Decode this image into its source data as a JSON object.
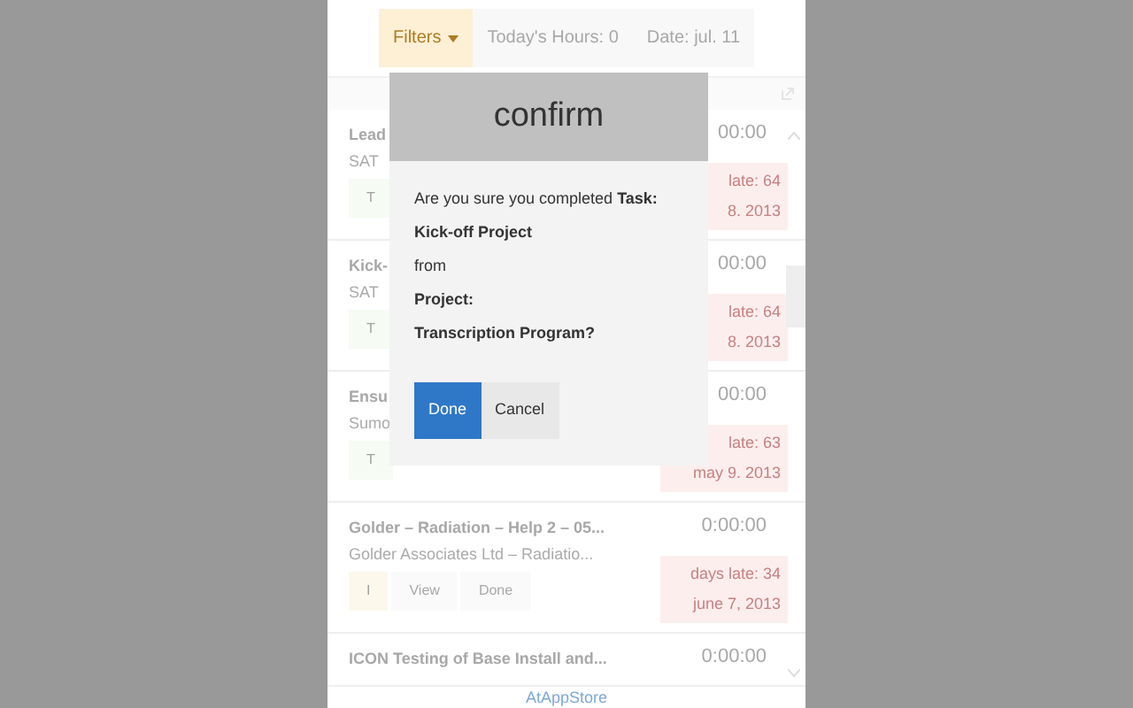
{
  "toolbar": {
    "filters": "Filters",
    "hours": "Today's Hours: 0",
    "date": "Date: jul. 11"
  },
  "tasks": [
    {
      "title": "Lead",
      "client": "SAT",
      "time": "00:00",
      "late": "late: 64",
      "due": "8. 2013",
      "buttons": [
        "T"
      ],
      "color": "#f6fbf3"
    },
    {
      "title": "Kick-",
      "client": "SAT",
      "time": "00:00",
      "late": "late: 64",
      "due": "8. 2013",
      "buttons": [
        "T"
      ],
      "color": "#f6fbf3"
    },
    {
      "title": "Ensu",
      "client": "Sumo",
      "time": "00:00",
      "late": "late: 63",
      "due": "may 9. 2013",
      "buttons": [
        "T"
      ],
      "color": "#f6fbf3"
    },
    {
      "title": "Golder – Radiation – Help 2 – 05...",
      "client": "Golder Associates Ltd – Radiatio...",
      "time": "0:00:00",
      "late": "days late: 34",
      "due": "june 7, 2013",
      "buttons": [
        "I",
        "View",
        "Done"
      ],
      "color": "#fdf8ec"
    },
    {
      "title": "ICON Testing of Base Install and...",
      "time": "0:00:00"
    }
  ],
  "footer": "AtAppStore",
  "dialog": {
    "title": "confirm",
    "lines": [
      {
        "text": "Are you sure you completed **Task:**",
        "bold": false
      },
      {
        "text": "Kick-off Project",
        "bold": true
      },
      {
        "text": "from",
        "bold": false
      },
      {
        "text": "Project:",
        "bold": true
      },
      {
        "text": "Transcription Program?",
        "bold": true
      }
    ],
    "buttons": [
      {
        "label": "Done",
        "kind": "primary"
      },
      {
        "label": "Cancel",
        "kind": "secondary"
      }
    ]
  }
}
